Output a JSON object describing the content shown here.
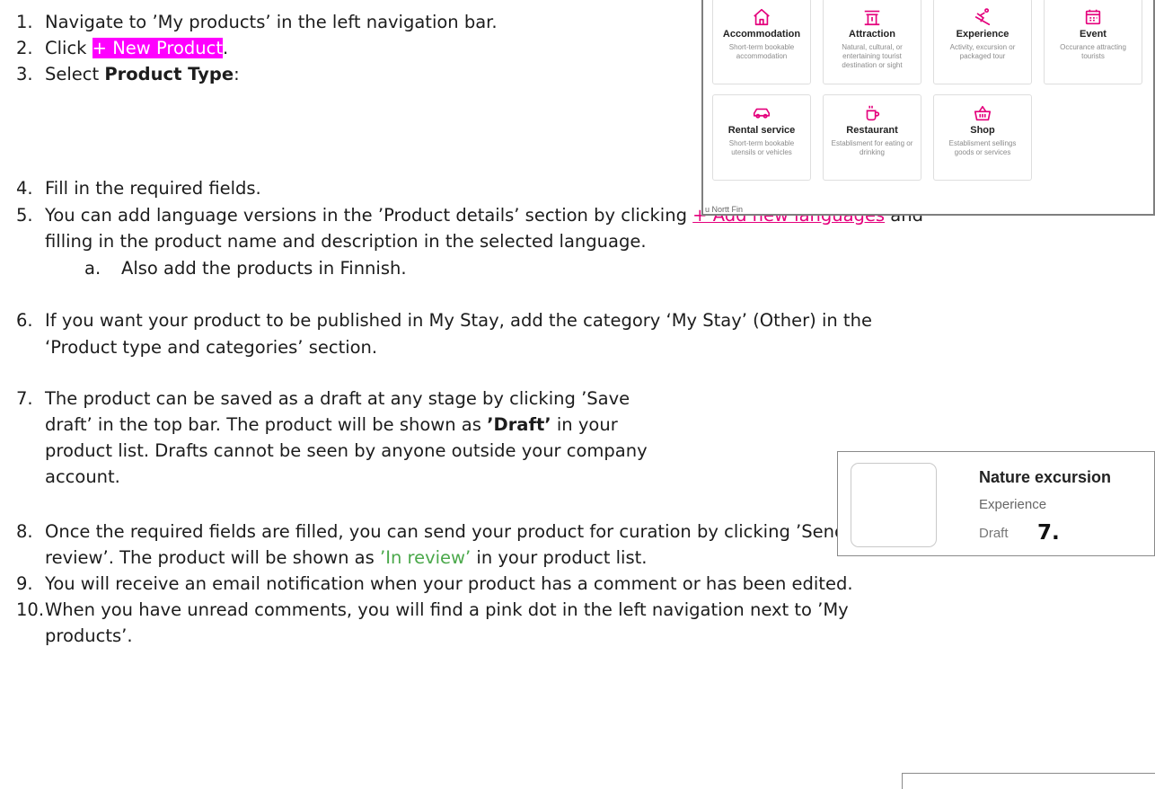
{
  "steps": {
    "s1": {
      "num": "1.",
      "text": "Navigate to ’My products’ in the left navigation bar."
    },
    "s2": {
      "num": "2.",
      "pre": "Click ",
      "highlight": "+ New Product",
      "post": "."
    },
    "s3": {
      "num": "3.",
      "pre": "Select ",
      "bold": "Product Type",
      "post": ":"
    },
    "s4": {
      "num": "4.",
      "text": "Fill in the required fields."
    },
    "s5": {
      "num": "5.",
      "pre": "You can add language versions in the ’Product details’ section by clicking ",
      "link": "+ Add new languages",
      "post": " and",
      "line2": "filling in the product name and description in the selected language."
    },
    "s5a": {
      "num": "a.",
      "text": "Also add the products in Finnish."
    },
    "s6": {
      "num": "6.",
      "line1": "If you want your product to be published in My Stay, add the category ‘My Stay’ (Other) in the",
      "line2": "‘Product type and categories’ section."
    },
    "s7": {
      "num": "7.",
      "line1": "The product can be saved as a draft at any stage by clicking ’Save",
      "line2_pre": "draft’ in the top bar. The product will be shown as ",
      "line2_bold": "’Draft’",
      "line2_post": " in your",
      "line3": "product list. Drafts cannot be seen by anyone outside your company",
      "line4": "account."
    },
    "s8": {
      "num": "8.",
      "line1": "Once the required fields are filled, you can send your product for curation by clicking ’Send for",
      "line2_pre": "review’. The product will be shown as ",
      "line2_green": "’In review’",
      "line2_post": " in your product list."
    },
    "s9": {
      "num": "9.",
      "text": "You will receive an email notification when your product has a comment or has been edited."
    },
    "s10": {
      "num": "10.",
      "line1": "When you have unread comments, you will find a pink dot in the left navigation next to ’My",
      "line2": "products’."
    }
  },
  "product_types": [
    {
      "title": "Accommodation",
      "desc": "Short-term bookable accommodation",
      "icon": "house-icon"
    },
    {
      "title": "Attraction",
      "desc": "Natural, cultural, or entertaining tourist destination or sight",
      "icon": "landmark-icon"
    },
    {
      "title": "Experience",
      "desc": "Activity, excursion or packaged tour",
      "icon": "skier-icon"
    },
    {
      "title": "Event",
      "desc": "Occurance attracting tourists",
      "icon": "calendar-icon"
    },
    {
      "title": "Rental service",
      "desc": "Short-term bookable utensils or vehicles",
      "icon": "car-icon"
    },
    {
      "title": "Restaurant",
      "desc": "Establisment for eating or drinking",
      "icon": "cup-icon"
    },
    {
      "title": "Shop",
      "desc": "Establisment sellings goods or services",
      "icon": "basket-icon"
    }
  ],
  "panel_fragment": "u Nortt Fin",
  "draft_card": {
    "name": "Nature excursion",
    "type": "Experience",
    "status": "Draft",
    "marker": "7."
  },
  "colors": {
    "highlight": "#ff00ff",
    "link_pink": "#e4007c",
    "review_green": "#4aa84a",
    "icon_pink": "#e4007c"
  }
}
